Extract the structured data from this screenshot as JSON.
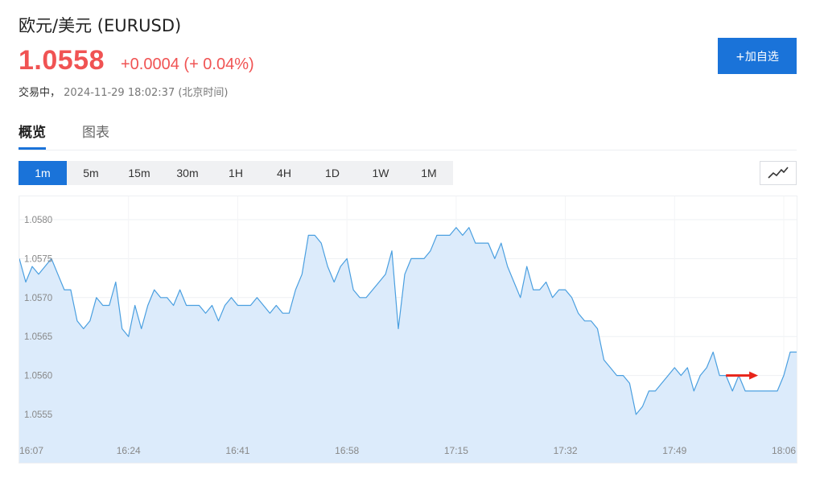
{
  "header": {
    "title": "欧元/美元 (EURUSD)",
    "price": "1.0558",
    "change": "+0.0004 (+ 0.04%)",
    "status": "交易中，",
    "timestamp": "2024-11-29 18:02:37 (北京时间)",
    "add_watchlist_label": "+加自选"
  },
  "tabs": [
    {
      "label": "概览",
      "active": true
    },
    {
      "label": "图表",
      "active": false
    }
  ],
  "periods": [
    {
      "label": "1m",
      "active": true
    },
    {
      "label": "5m",
      "active": false
    },
    {
      "label": "15m",
      "active": false
    },
    {
      "label": "30m",
      "active": false
    },
    {
      "label": "1H",
      "active": false
    },
    {
      "label": "4H",
      "active": false
    },
    {
      "label": "1D",
      "active": false
    },
    {
      "label": "1W",
      "active": false
    },
    {
      "label": "1M",
      "active": false
    }
  ],
  "chart_type_icon": "line-chart-icon",
  "colors": {
    "up": "#f05353",
    "accent": "#1a73d9",
    "line": "#4a9fe0",
    "area": "#dcebfb",
    "arrow": "#e8241a"
  },
  "chart_data": {
    "type": "area",
    "title": "",
    "xlabel": "",
    "ylabel": "",
    "x_range_minutes": [
      0,
      121
    ],
    "ylim": [
      1.0552,
      1.0583
    ],
    "y_ticks": [
      "1.0555",
      "1.0560",
      "1.0565",
      "1.0570",
      "1.0575",
      "1.0580"
    ],
    "x_ticks": [
      {
        "label": "16:07",
        "minute": 0
      },
      {
        "label": "16:24",
        "minute": 17
      },
      {
        "label": "16:41",
        "minute": 34
      },
      {
        "label": "16:58",
        "minute": 51
      },
      {
        "label": "17:15",
        "minute": 68
      },
      {
        "label": "17:32",
        "minute": 85
      },
      {
        "label": "17:49",
        "minute": 102
      },
      {
        "label": "18:06",
        "minute": 119
      }
    ],
    "grid": true,
    "annotation": {
      "type": "arrow",
      "from": [
        110,
        1.056
      ],
      "to": [
        115,
        1.056
      ],
      "color": "#e8241a"
    },
    "x": [
      0,
      1,
      2,
      3,
      4,
      5,
      6,
      7,
      8,
      9,
      10,
      11,
      12,
      13,
      14,
      15,
      16,
      17,
      18,
      19,
      20,
      21,
      22,
      23,
      24,
      25,
      26,
      27,
      28,
      29,
      30,
      31,
      32,
      33,
      34,
      35,
      36,
      37,
      38,
      39,
      40,
      41,
      42,
      43,
      44,
      45,
      46,
      47,
      48,
      49,
      50,
      51,
      52,
      53,
      54,
      55,
      56,
      57,
      58,
      59,
      60,
      61,
      62,
      63,
      64,
      65,
      66,
      67,
      68,
      69,
      70,
      71,
      72,
      73,
      74,
      75,
      76,
      77,
      78,
      79,
      80,
      81,
      82,
      83,
      84,
      85,
      86,
      87,
      88,
      89,
      90,
      91,
      92,
      93,
      94,
      95,
      96,
      97,
      98,
      99,
      100,
      101,
      102,
      103,
      104,
      105,
      106,
      107,
      108,
      109,
      110,
      111,
      112,
      113,
      114,
      115,
      116,
      117,
      118,
      119,
      120,
      121
    ],
    "values": [
      1.0575,
      1.0572,
      1.0574,
      1.0573,
      1.0574,
      1.0575,
      1.0573,
      1.0571,
      1.0571,
      1.0567,
      1.0566,
      1.0567,
      1.057,
      1.0569,
      1.0569,
      1.0572,
      1.0566,
      1.0565,
      1.0569,
      1.0566,
      1.0569,
      1.0571,
      1.057,
      1.057,
      1.0569,
      1.0571,
      1.0569,
      1.0569,
      1.0569,
      1.0568,
      1.0569,
      1.0567,
      1.0569,
      1.057,
      1.0569,
      1.0569,
      1.0569,
      1.057,
      1.0569,
      1.0568,
      1.0569,
      1.0568,
      1.0568,
      1.0571,
      1.0573,
      1.0578,
      1.0578,
      1.0577,
      1.0574,
      1.0572,
      1.0574,
      1.0575,
      1.0571,
      1.057,
      1.057,
      1.0571,
      1.0572,
      1.0573,
      1.0576,
      1.0566,
      1.0573,
      1.0575,
      1.0575,
      1.0575,
      1.0576,
      1.0578,
      1.0578,
      1.0578,
      1.0579,
      1.0578,
      1.0579,
      1.0577,
      1.0577,
      1.0577,
      1.0575,
      1.0577,
      1.0574,
      1.0572,
      1.057,
      1.0574,
      1.0571,
      1.0571,
      1.0572,
      1.057,
      1.0571,
      1.0571,
      1.057,
      1.0568,
      1.0567,
      1.0567,
      1.0566,
      1.0562,
      1.0561,
      1.056,
      1.056,
      1.0559,
      1.0555,
      1.0556,
      1.0558,
      1.0558,
      1.0559,
      1.056,
      1.0561,
      1.056,
      1.0561,
      1.0558,
      1.056,
      1.0561,
      1.0563,
      1.056,
      1.056,
      1.0558,
      1.056,
      1.0558,
      1.0558,
      1.0558,
      1.0558,
      1.0558,
      1.0558,
      1.056,
      1.0563,
      1.0563,
      1.0565,
      1.0566,
      1.0564,
      1.0565
    ]
  }
}
